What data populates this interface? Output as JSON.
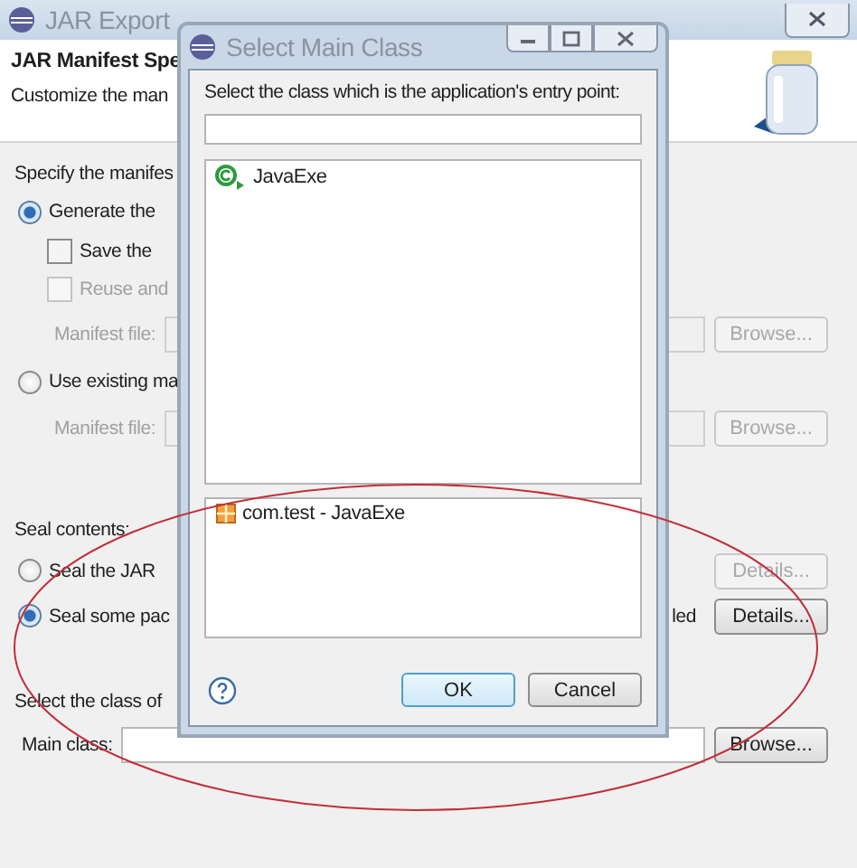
{
  "window": {
    "title": "JAR Export"
  },
  "header": {
    "title": "JAR Manifest Spe",
    "subtitle": "Customize the man"
  },
  "groups": [
    {
      "rows": [
        {
          "kind": "text",
          "label": "Specify the manifes"
        },
        {
          "kind": "radio",
          "label": "Generate the",
          "selected": true
        },
        {
          "kind": "checkbox",
          "label": "Save the",
          "checked": false,
          "disabled": false
        },
        {
          "kind": "checkbox",
          "label": "Reuse and",
          "checked": false,
          "disabled": true
        },
        {
          "kind": "file",
          "label": "Manifest file:",
          "button": "Browse...",
          "disabled": true
        },
        {
          "kind": "radio",
          "label": "Use existing ma",
          "selected": false
        },
        {
          "kind": "file",
          "label": "Manifest file:",
          "button": "Browse...",
          "disabled": true
        }
      ]
    },
    {
      "rows": [
        {
          "kind": "text",
          "label": "Seal contents:"
        },
        {
          "kind": "seal",
          "label": "Seal the JAR",
          "selected": false,
          "button": "Details...",
          "disabled": true
        },
        {
          "kind": "seal",
          "label": "Seal some pac",
          "selected": true,
          "trailing": "led",
          "button": "Details...",
          "disabled": false
        }
      ]
    },
    {
      "rows": [
        {
          "kind": "text",
          "label": "Select the class of"
        },
        {
          "kind": "main",
          "label": "Main class:",
          "button": "Browse...",
          "disabled": false
        }
      ]
    }
  ],
  "dialog": {
    "title": "Select Main Class",
    "prompt": "Select the class which is the application's entry point:",
    "classes": [
      {
        "label": "JavaExe",
        "selected": false
      }
    ],
    "packages": [
      {
        "label": "com.test - JavaExe"
      }
    ],
    "buttons": [
      {
        "label": "OK",
        "default": true
      },
      {
        "label": "Cancel",
        "default": false
      }
    ]
  }
}
